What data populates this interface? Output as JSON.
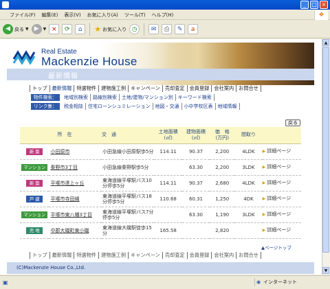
{
  "browser": {
    "menu": [
      "ファイル(F)",
      "編集(E)",
      "表示(V)",
      "お気に入り(A)",
      "ツール(T)",
      "ヘルプ(H)"
    ],
    "toolbar": {
      "back_label": "戻る",
      "favorites_label": "お気に入り"
    },
    "status_zone": "インターネット"
  },
  "header": {
    "brand_small": "Real Estate",
    "brand_big": "Mackenzie House",
    "section_title": "最新情報",
    "colors": {
      "accent": "#0d3b8c",
      "bar": "#c9d6ec"
    }
  },
  "nav": {
    "items": [
      "トップ",
      "最新情報",
      "特選物件",
      "建物施工例",
      "キャンペーン",
      "売却査定",
      "会員登録",
      "会社案内",
      "お問合せ"
    ]
  },
  "subnav": {
    "search_badge": "物件検索：",
    "search_links": [
      "地域別検索",
      "路線別検索",
      "土地/建物/マンション別",
      "キーワード検索"
    ],
    "link_badge": "リンク集：",
    "link_links": [
      "税金相談",
      "住宅ローンシュミレーション",
      "地図・交通",
      "小中学校区表",
      "地域情報"
    ]
  },
  "back_button": "戻る",
  "table": {
    "headers": {
      "location": "所　在",
      "traffic": "交　通",
      "land": "土地面積\n(㎡)",
      "building": "建物面積\n(㎡)",
      "price": "価　格\n(万円)",
      "layout": "間取り"
    },
    "rows": [
      {
        "type": "新 築",
        "type_color": "#c0397b",
        "address": "小田原市",
        "traffic": "小田急線小田原駅歩5分",
        "land": "114.11",
        "building": "90.37",
        "price": "2,200",
        "layout": "4LDK",
        "detail": "詳細ページ"
      },
      {
        "type": "マンション",
        "type_color": "#3c9a3c",
        "address": "秦野市3丁目",
        "traffic": "小田急線秦野駅歩5分",
        "land": "",
        "building": "63.30",
        "price": "2,200",
        "layout": "3LDK",
        "detail": "詳細ページ"
      },
      {
        "type": "新 築",
        "type_color": "#c0397b",
        "address": "平塚市達上ヶ丘",
        "traffic": "東海道線平塚駅バス10分停歩5分",
        "land": "114.11",
        "building": "90.37",
        "price": "2,680",
        "layout": "4LDK",
        "detail": "詳細ページ"
      },
      {
        "type": "戸 建",
        "type_color": "#2c58a8",
        "address": "平塚市寺田縄",
        "traffic": "東海道線平塚駅バス18分停歩5分",
        "land": "110.68",
        "building": "60.31",
        "price": "1,250",
        "layout": "4DK",
        "detail": "詳細ページ"
      },
      {
        "type": "マンション",
        "type_color": "#3c9a3c",
        "address": "平塚市東八幡3丁目",
        "traffic": "東海道線平塚駅バス7分停歩5分",
        "land": "",
        "building": "63.30",
        "price": "1,190",
        "layout": "3LDK",
        "detail": "詳細ページ"
      },
      {
        "type": "売 地",
        "type_color": "#2e8a6a",
        "address": "中郡大磯町東小磯",
        "traffic": "東海道線大磯駅徒歩15分",
        "land": "165.58",
        "building": "",
        "price": "2,820",
        "layout": "",
        "detail": "詳細ページ"
      }
    ]
  },
  "page_top": "ページトップ",
  "footer": {
    "copyright": "(C)Mackenzie House Co.,Ltd."
  }
}
